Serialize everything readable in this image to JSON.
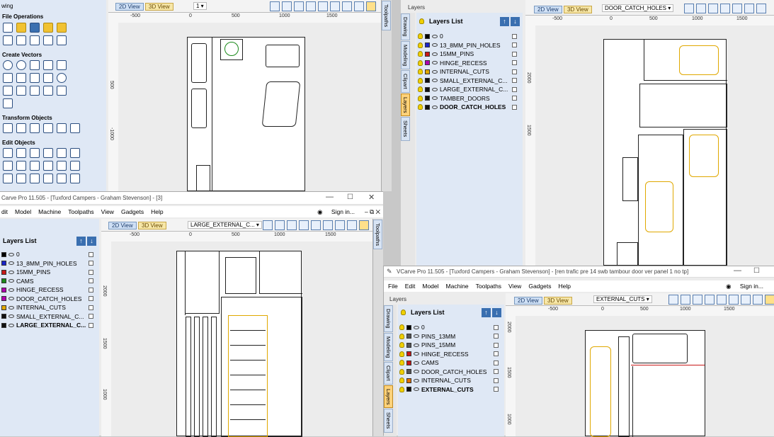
{
  "tl": {
    "title_fragment": "wing",
    "sections": [
      "File Operations",
      "Create Vectors",
      "Transform Objects",
      "Edit Objects"
    ],
    "view_tabs": [
      "2D View",
      "3D View"
    ],
    "layer_select": "1",
    "ruler_top": [
      "-500",
      "0",
      "500",
      "1000",
      "1500"
    ],
    "ruler_left": [
      "500",
      "-1000"
    ],
    "side_tabs": [
      "Toolpaths"
    ]
  },
  "tr": {
    "panel_title": "Layers",
    "header": "Layers List",
    "layers": [
      "0",
      "13_8MM_PIN_HOLES",
      "15MM_PINS",
      "HINGE_RECESS",
      "INTERNAL_CUTS",
      "SMALL_EXTERNAL_C...",
      "LARGE_EXTERNAL_C...",
      "TAMBER_DOORS",
      "DOOR_CATCH_HOLES"
    ],
    "layer_colors": [
      "#000000",
      "#1a24c9",
      "#c81818",
      "#b000b0",
      "#e0a800",
      "#111111",
      "#111111",
      "#111111",
      "#111111"
    ],
    "side_tabs": [
      "Drawing",
      "Modeling",
      "Clipart",
      "Layers",
      "Sheets"
    ],
    "view_tabs": [
      "2D View",
      "3D View"
    ],
    "layer_select": "DOOR_CATCH_HOLES",
    "ruler_top": [
      "-500",
      "0",
      "500",
      "1000",
      "1500"
    ],
    "ruler_left": [
      "2000",
      "1500"
    ]
  },
  "bl": {
    "title": "Carve Pro 11.505 - [Tuxford Campers - Graham Stevenson] - [3]",
    "menu": [
      "dit",
      "Model",
      "Machine",
      "Toolpaths",
      "View",
      "Gadgets",
      "Help"
    ],
    "sign_in": "Sign in...",
    "header": "Layers List",
    "layers": [
      "0",
      "13_8MM_PIN_HOLES",
      "15MM_PINS",
      "CAMS",
      "HINGE_RECESS",
      "DOOR_CATCH_HOLES",
      "INTERNAL_CUTS",
      "SMALL_EXTERNAL_C...",
      "LARGE_EXTERNAL_C..."
    ],
    "layer_colors": [
      "#000000",
      "#1a24c9",
      "#c81818",
      "#1a8a1a",
      "#b000b0",
      "#b000b0",
      "#e0a800",
      "#111111",
      "#111111"
    ],
    "view_tabs": [
      "2D View",
      "3D View"
    ],
    "layer_select": "LARGE_EXTERNAL_C...",
    "ruler_top": [
      "-500",
      "0",
      "500",
      "1000",
      "1500"
    ],
    "ruler_left": [
      "2000",
      "1500",
      "1000"
    ],
    "side_tabs": [
      "Toolpaths"
    ]
  },
  "br": {
    "title": "VCarve Pro 11.505 - [Tuxford Campers - Graham Stevenson] - [ren trafic pre 14 swb tambour door ver panel 1 no tp]",
    "menu": [
      "File",
      "Edit",
      "Model",
      "Machine",
      "Toolpaths",
      "View",
      "Gadgets",
      "Help"
    ],
    "sign_in": "Sign in...",
    "panel_title": "Layers",
    "header": "Layers List",
    "layers": [
      "0",
      "PINS_13MM",
      "PINS_15MM",
      "HINGE_RECESS",
      "CAMS",
      "DOOR_CATCH_HOLES",
      "INTERNAL_CUTS",
      "EXTERNAL_CUTS"
    ],
    "layer_colors": [
      "#000000",
      "#555555",
      "#555555",
      "#c81818",
      "#c81818",
      "#555555",
      "#e07000",
      "#111111"
    ],
    "side_tabs": [
      "Drawing",
      "Modeling",
      "Clipart",
      "Layers",
      "Sheets"
    ],
    "view_tabs": [
      "2D View",
      "3D View"
    ],
    "layer_select": "EXTERNAL_CUTS",
    "ruler_top": [
      "-500",
      "0",
      "500",
      "1000",
      "1500"
    ],
    "ruler_left": [
      "2000",
      "1500",
      "1000"
    ]
  }
}
